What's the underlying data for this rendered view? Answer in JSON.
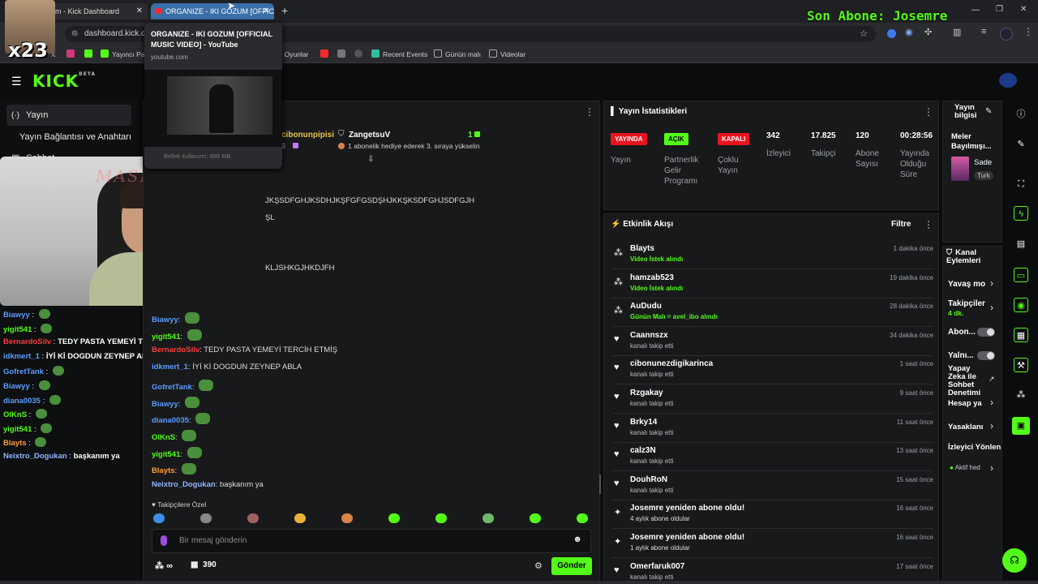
{
  "overlay": {
    "last_sub": "Son Abone: Josemre",
    "multiplier": "x23",
    "cam_watermark": "MASKAR"
  },
  "browser": {
    "tab1": "m - Kick Dashboard",
    "tab2": "ORGANIZE - IKI GOZUM [OFFIC",
    "url": "dashboard.kick.co",
    "bookmarks": [
      "Yayıncı Pan",
      "k Oyunlar",
      "Recent Events",
      "Günün malı",
      "Videolar"
    ]
  },
  "tooltip": {
    "title": "ORGANIZE - IKI GOZUM [OFFICIAL MUSIC VIDEO] - YouTube",
    "domain": "youtube.com",
    "memory": "Bellek kullanımı: 685 MB"
  },
  "nav": {
    "item1": "Yayın",
    "item2": "Yayın Bağlantısı ve Anahtarı",
    "item3": "Sohbet"
  },
  "side_chat": [
    {
      "user": "Biawyy",
      "msg": "",
      "color": "#5b9cff"
    },
    {
      "user": "yigit541",
      "msg": "",
      "color": "#53fc18"
    },
    {
      "user": "BernardoSilv",
      "msg": "TEDY PASTA YEMEYİ TERCİH ETMİŞ",
      "color": "#ff3b3b"
    },
    {
      "user": "idkmert_1",
      "msg": "İYİ Kİ DOGDUN ZEYNEP ABLA",
      "color": "#5b9cff"
    },
    {
      "user": "GofretTank",
      "msg": "",
      "color": "#5b9cff"
    },
    {
      "user": "Biawyy",
      "msg": "",
      "color": "#5b9cff"
    },
    {
      "user": "diana0035",
      "msg": "",
      "color": "#5b9cff"
    },
    {
      "user": "OlKnS",
      "msg": "",
      "color": "#53fc18"
    },
    {
      "user": "yigit541",
      "msg": "",
      "color": "#53fc18"
    },
    {
      "user": "Blayts",
      "msg": "",
      "color": "#ff9d3b"
    },
    {
      "user": "Neixtro_Dogukan",
      "msg": "başkanım ya",
      "color": "#8fb6ff"
    }
  ],
  "chat": {
    "pinned_user1": "cibonunpipisi",
    "pinned_user2": "ZangetsuV",
    "pinned_count": "1",
    "pinned_num": "6",
    "pinned_msg": "1 abonelik hediye ederek 3. sıraya yükselin",
    "spam1": "JKŞSDFGHJKSDHJKŞFGFGSDŞHJKKŞKSDFGHJSDFGJH",
    "spam2": "ŞL",
    "spam3": "KLJSHKGJHKDJFH",
    "lines": [
      {
        "user": "Biawyy",
        "msg": "",
        "color": "#5b9cff"
      },
      {
        "user": "yigit541",
        "msg": "",
        "color": "#53fc18"
      },
      {
        "user": "BernardoSilv",
        "msg": "TEDY PASTA YEMEYİ TERCİH ETMİŞ",
        "color": "#ff3b3b"
      },
      {
        "user": "idkmert_1",
        "msg": "İYİ Kİ DOGDUN ZEYNEP ABLA",
        "color": "#5b9cff"
      },
      {
        "user": "GofretTank",
        "msg": "",
        "color": "#5b9cff"
      },
      {
        "user": "Biawyy",
        "msg": "",
        "color": "#5b9cff"
      },
      {
        "user": "diana0035",
        "msg": "",
        "color": "#5b9cff"
      },
      {
        "user": "OlKnS",
        "msg": "",
        "color": "#53fc18"
      },
      {
        "user": "yigit541",
        "msg": "",
        "color": "#53fc18"
      },
      {
        "user": "Blayts",
        "msg": "",
        "color": "#ff9d3b"
      },
      {
        "user": "Neixtro_Dogukan",
        "msg": "başkanım ya",
        "color": "#8fb6ff"
      }
    ],
    "followers_only": "Takipçilere Özel",
    "placeholder": "Bir mesaj gönderin",
    "points_inf": "∞",
    "points": "390",
    "send": "Gönder"
  },
  "stats": {
    "title": "Yayın İstatistikleri",
    "live_badge": "YAYINDA",
    "live_label": "Yayın",
    "partner_badge": "AÇIK",
    "partner_label": "Partnerlik Gelir Programı",
    "multi_badge": "KAPALI",
    "multi_label": "Çoklu Yayın",
    "viewers": "342",
    "viewers_label": "İzleyici",
    "followers": "17.825",
    "followers_label": "Takipçi",
    "subs": "120",
    "subs_label": "Abone Sayısı",
    "uptime": "00:28:56",
    "uptime_label": "Yayında Olduğu Süre"
  },
  "activity": {
    "title": "Etkinlik Akışı",
    "filter": "Filtre",
    "items": [
      {
        "name": "Blayts",
        "sub": "Video İstek alındı",
        "time": "1 dakika önce",
        "icon": "gift"
      },
      {
        "name": "hamzab523",
        "sub": "Video İstek alındı",
        "time": "19 dakika önce",
        "icon": "gift"
      },
      {
        "name": "AuDudu",
        "sub": "Günün Malı = avel_ibo alındı",
        "time": "28 dakika önce",
        "icon": "gift"
      },
      {
        "name": "Caannszx",
        "sub": "kanalı takip etti",
        "time": "34 dakika önce",
        "icon": "heart"
      },
      {
        "name": "cibonunezdigikarinca",
        "sub": "kanalı takip etti",
        "time": "1 saat önce",
        "icon": "heart"
      },
      {
        "name": "Rzgakay",
        "sub": "kanalı takip etti",
        "time": "9 saat önce",
        "icon": "heart"
      },
      {
        "name": "Brky14",
        "sub": "kanalı takip etti",
        "time": "11 saat önce",
        "icon": "heart"
      },
      {
        "name": "calz3N",
        "sub": "kanalı takip etti",
        "time": "13 saat önce",
        "icon": "heart"
      },
      {
        "name": "DouhRoN",
        "sub": "kanalı takip etti",
        "time": "15 saat önce",
        "icon": "heart"
      },
      {
        "name": "Josemre yeniden abone oldu!",
        "sub": "4 aylık abone oldular",
        "time": "16 saat önce",
        "icon": "star"
      },
      {
        "name": "Josemre yeniden abone oldu!",
        "sub": "1 aylık abone oldular",
        "time": "16 saat önce",
        "icon": "star"
      },
      {
        "name": "Omerfaruk007",
        "sub": "kanalı takip etti",
        "time": "17 saat önce",
        "icon": "heart"
      }
    ]
  },
  "right": {
    "info_title": "Yayın bilgisi",
    "info_text": "Meler Bayılmışı...",
    "info_sub": "Sade",
    "info_tag": "Turk",
    "actions_title": "Kanal Eylemleri",
    "slow": "Yavaş mo",
    "followers": "Takipçiler",
    "followers_val": "4 dk.",
    "subs": "Abon...",
    "emote": "Yalnı...",
    "ai": "Yapay Zeka ile Sohbet Denetimi",
    "account": "Hesap ya",
    "bans": "Yasaklanı",
    "viewer_dir": "İzleyici Yönlen",
    "active": "Aktif hed"
  },
  "colors": {
    "accent": "#53fc18",
    "panel": "#18191b"
  }
}
